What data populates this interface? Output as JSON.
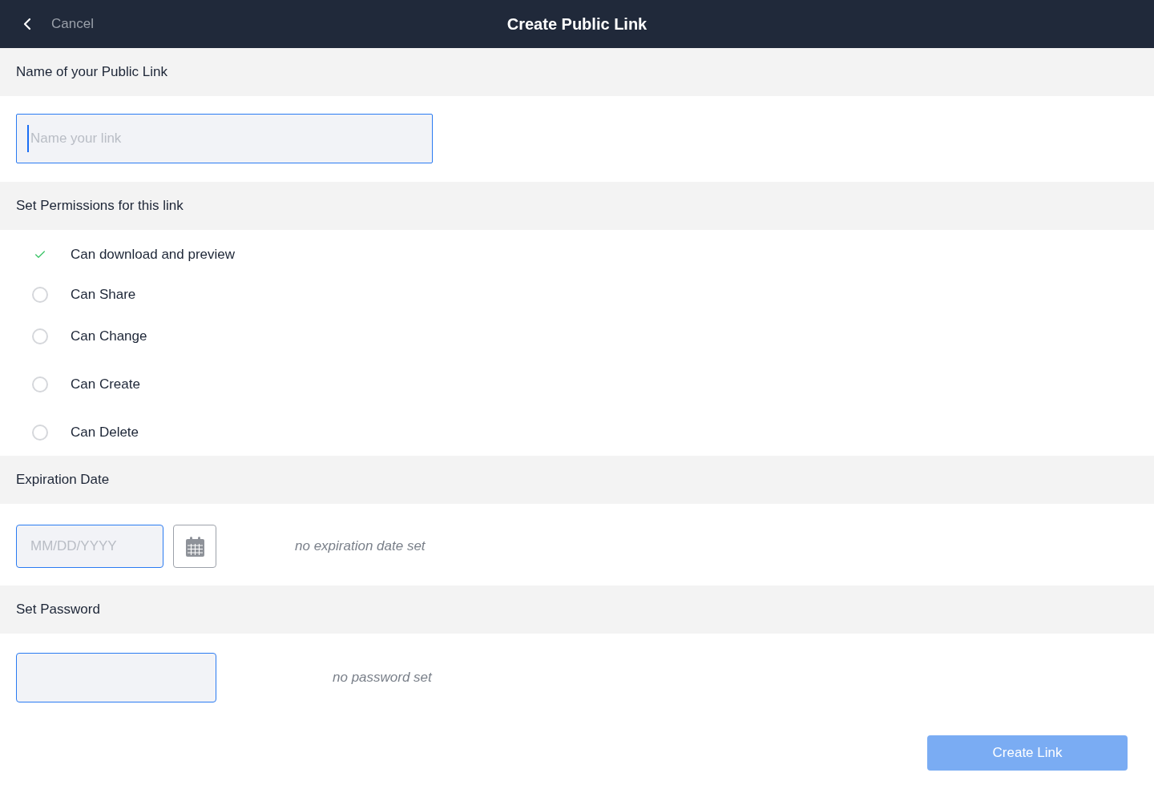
{
  "header": {
    "back_label": "Cancel",
    "title": "Create Public Link"
  },
  "name_section": {
    "heading": "Name of your Public Link",
    "field": {
      "placeholder": "Name your link",
      "focused": true
    }
  },
  "permissions_section": {
    "heading": "Set Permissions for this link",
    "options": [
      {
        "label": "Can download and preview",
        "checked": true
      },
      {
        "label": "Can Share",
        "checked": false
      },
      {
        "label": "Can Change",
        "checked": false
      },
      {
        "label": "Can Create",
        "checked": false
      },
      {
        "label": "Can Delete",
        "checked": false
      }
    ]
  },
  "expiration_section": {
    "heading": "Expiration Date",
    "field": {
      "placeholder": "MM/DD/YYYY"
    },
    "hint": "no expiration date set"
  },
  "password_section": {
    "heading": "Set Password",
    "hint": "no password set"
  },
  "create_button": {
    "label": "Create Link",
    "disabled": true
  }
}
